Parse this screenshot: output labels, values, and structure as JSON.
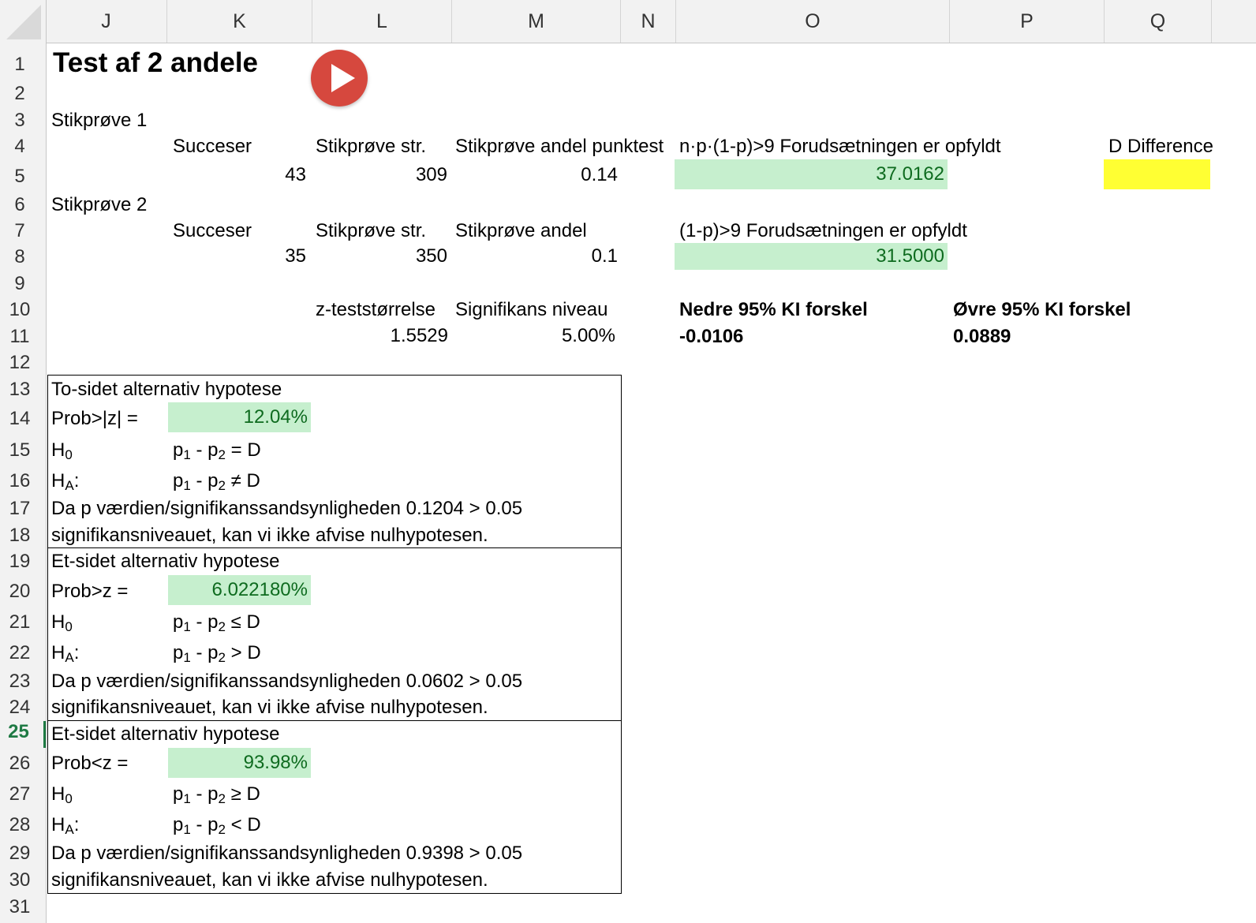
{
  "columns": [
    "J",
    "K",
    "L",
    "M",
    "N",
    "O",
    "P",
    "Q"
  ],
  "rows": [
    "1",
    "2",
    "3",
    "4",
    "5",
    "6",
    "7",
    "8",
    "9",
    "10",
    "11",
    "12",
    "13",
    "14",
    "15",
    "16",
    "17",
    "18",
    "19",
    "20",
    "21",
    "22",
    "23",
    "24",
    "25",
    "26",
    "27",
    "28",
    "29",
    "30",
    "31"
  ],
  "active_row": "25",
  "title": "Test af 2 andele",
  "sample1": {
    "heading": "Stikprøve 1",
    "successes_label": "Succeser",
    "size_label": "Stikprøve str.",
    "proportion_label": "Stikprøve andel punktest",
    "successes": "43",
    "size": "309",
    "proportion": "0.14",
    "condition_label": "n·p·(1-p)>9 Forudsætningen er opfyldt",
    "condition_value": "37.0162"
  },
  "sample2": {
    "heading": "Stikprøve 2",
    "successes_label": "Succeser",
    "size_label": "Stikprøve str.",
    "proportion_label": "Stikprøve andel",
    "successes": "35",
    "size": "350",
    "proportion": "0.1",
    "condition_label": "(1-p)>9 Forudsætningen er opfyldt",
    "condition_value": "31.5000"
  },
  "difference_label": "D Difference",
  "difference_value": "",
  "ztest_label": "z-teststørrelse",
  "ztest_value": "1.5529",
  "significance_label": "Signifikans niveau",
  "significance_value": "5.00%",
  "ci_lower_label": "Nedre 95% KI forskel",
  "ci_lower_value": "-0.0106",
  "ci_upper_label": "Øvre 95% KI forskel",
  "ci_upper_value": "0.0889",
  "tests": [
    {
      "heading": "To-sidet alternativ hypotese",
      "prob_label": "Prob>|z| =",
      "prob_value": "12.04%",
      "h0_label": "H",
      "h0_sub": "0",
      "ha_label": "H",
      "ha_sub": "A",
      "ha_colon": ":",
      "h0_op": "= D",
      "ha_op": "≠ D",
      "conclusion1": "Da p værdien/signifikanssandsynligheden 0.1204 > 0.05",
      "conclusion2": "signifikansniveauet, kan vi ikke afvise nulhypotesen."
    },
    {
      "heading": "Et-sidet alternativ hypotese",
      "prob_label": "Prob>z =",
      "prob_value": "6.022180%",
      "h0_label": "H",
      "h0_sub": "0",
      "ha_label": "H",
      "ha_sub": "A",
      "ha_colon": ":",
      "h0_op": "≤ D",
      "ha_op": "> D",
      "conclusion1": "Da p værdien/signifikanssandsynligheden 0.0602 > 0.05",
      "conclusion2": "signifikansniveauet, kan vi ikke afvise nulhypotesen."
    },
    {
      "heading": "Et-sidet alternativ hypotese",
      "prob_label": "Prob<z =",
      "prob_value": "93.98%",
      "h0_label": "H",
      "h0_sub": "0",
      "ha_label": "H",
      "ha_sub": "A",
      "ha_colon": ":",
      "h0_op": "≥ D",
      "ha_op": "< D",
      "conclusion1": "Da p værdien/signifikanssandsynligheden 0.9398 > 0.05",
      "conclusion2": "signifikansniveauet, kan vi ikke afvise nulhypotesen."
    }
  ],
  "hyp_p": "p",
  "hyp_sub1": "1",
  "hyp_minus": " - p",
  "hyp_sub2": "2",
  "colors": {
    "green_fill": "#c6efce",
    "green_text": "#0e6b1f",
    "yellow_fill": "#ffff33",
    "play_button": "#d6483e"
  },
  "icons": {
    "play": "play-icon"
  }
}
